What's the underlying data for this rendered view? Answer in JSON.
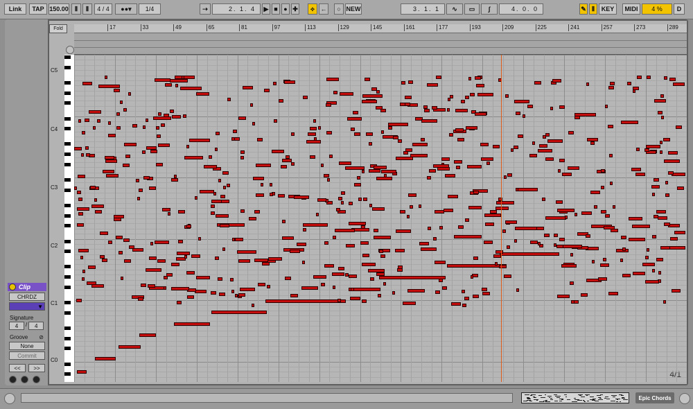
{
  "transport": {
    "link": "Link",
    "tap": "TAP",
    "tempo": "150.00",
    "signature": "4 / 4",
    "quantize": "1/4",
    "position": "2.  1.  4",
    "new": "NEW",
    "loop_start": "3.  1.  1",
    "loop_length": "4.  0.  0",
    "key": "KEY",
    "midi": "MIDI",
    "cpu": "4 %",
    "d": "D"
  },
  "editor": {
    "fold": "Fold",
    "ruler_ticks": [
      "17",
      "33",
      "49",
      "65",
      "81",
      "97",
      "113",
      "129",
      "145",
      "161",
      "177",
      "193",
      "209",
      "225",
      "241",
      "257",
      "273",
      "289"
    ],
    "octave_labels": [
      "C5",
      "C4",
      "C3",
      "C2",
      "C1",
      "C0"
    ],
    "grid_readout": "4/1"
  },
  "clip": {
    "title": "Clip",
    "name": "CHRDZ",
    "color": "#5b3fb6",
    "signature_label": "Signature",
    "sig_num": "4",
    "sig_den": "4",
    "groove_label": "Groove",
    "groove_value": "None",
    "commit": "Commit",
    "prev": "<<",
    "next": ">>"
  },
  "bottom": {
    "clip_name": "Epic Chords"
  },
  "colors": {
    "note": "#c40d0d",
    "playhead": "#e05a1a",
    "clip_purple": "#7a52c8",
    "highlight": "#f2c300"
  }
}
